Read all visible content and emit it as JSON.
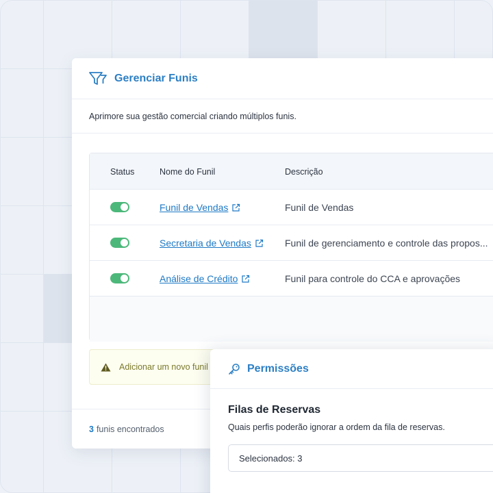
{
  "funnels": {
    "title": "Gerenciar Funis",
    "title_icon": "funnel-icon",
    "subtitle": "Aprimore sua gestão comercial criando múltiplos funis.",
    "columns": [
      "Status",
      "Nome do Funil",
      "Descrição"
    ],
    "rows": [
      {
        "status": "on",
        "name": "Funil de Vendas",
        "description": "Funil de Vendas"
      },
      {
        "status": "on",
        "name": "Secretaria de Vendas",
        "description": "Funil de gerenciamento e controle das propos..."
      },
      {
        "status": "on",
        "name": "Análise de Crédito",
        "description": "Funil para controle do CCA e aprovações"
      }
    ],
    "add_new": "Adicionar um novo funil",
    "found_count": "3",
    "found_label": "funis encontrados"
  },
  "permissions": {
    "title": "Permissões",
    "title_icon": "key-icon",
    "section_title": "Filas de Reservas",
    "section_desc": "Quais perfis poderão ignorar a ordem da fila de reservas.",
    "select_value": "Selecionados: 3"
  },
  "colors": {
    "accent": "#2c7fc4",
    "link": "#1d79c6",
    "toggle_on": "#4cb87a",
    "warning": "#7a7a2c"
  }
}
